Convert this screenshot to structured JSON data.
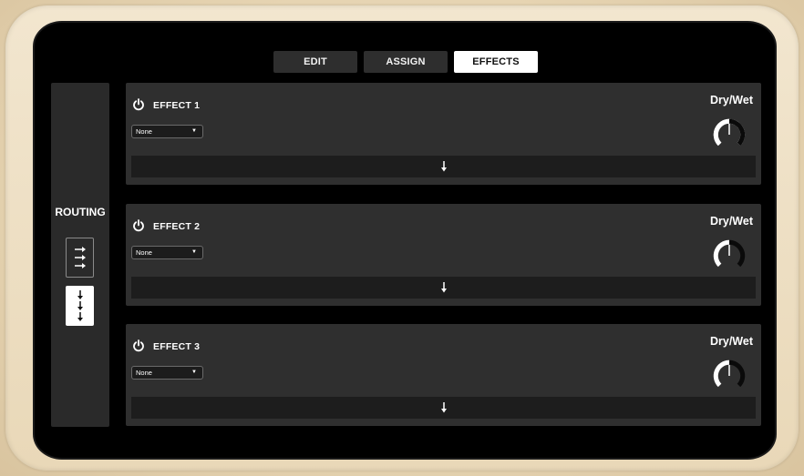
{
  "tabs": [
    {
      "label": "EDIT",
      "active": false
    },
    {
      "label": "ASSIGN",
      "active": false
    },
    {
      "label": "EFFECTS",
      "active": true
    }
  ],
  "routing": {
    "label": "ROUTING",
    "options": [
      {
        "icon": "parallel-arrows-icon",
        "selected": false
      },
      {
        "icon": "serial-arrows-icon",
        "selected": true
      }
    ]
  },
  "effects": [
    {
      "title": "EFFECT 1",
      "selected_effect": "None",
      "dry_wet_label": "Dry/Wet"
    },
    {
      "title": "EFFECT 2",
      "selected_effect": "None",
      "dry_wet_label": "Dry/Wet"
    },
    {
      "title": "EFFECT 3",
      "selected_effect": "None",
      "dry_wet_label": "Dry/Wet"
    }
  ],
  "colors": {
    "accent": "#ffffff",
    "panel": "#2f2f2f",
    "screen": "#000000",
    "bezel": "#e9d8b8"
  }
}
